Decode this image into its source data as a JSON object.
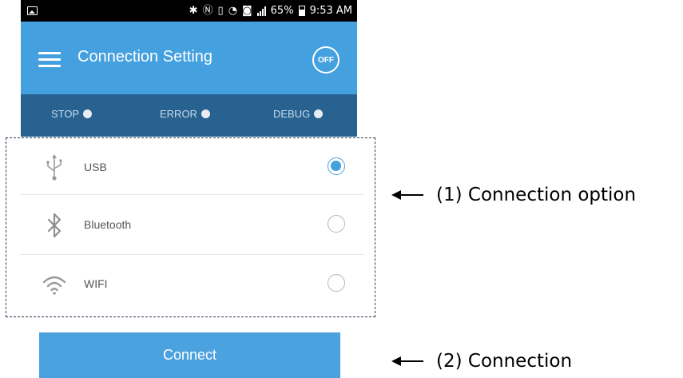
{
  "status_bar": {
    "battery_percent": "65%",
    "time": "9:53 AM"
  },
  "app_bar": {
    "title": "Connection Setting",
    "power_toggle_label": "OFF"
  },
  "indicators": [
    {
      "label": "STOP"
    },
    {
      "label": "ERROR"
    },
    {
      "label": "DEBUG"
    }
  ],
  "connection_options": [
    {
      "label": "USB",
      "icon": "usb-icon",
      "selected": true
    },
    {
      "label": "Bluetooth",
      "icon": "bluetooth-icon",
      "selected": false
    },
    {
      "label": "WIFI",
      "icon": "wifi-icon",
      "selected": false
    }
  ],
  "connect_button_label": "Connect",
  "annotations": [
    {
      "text": "(1) Connection option"
    },
    {
      "text": "(2) Connection"
    }
  ],
  "colors": {
    "app_bar": "#44a0de",
    "status_strip": "#286291",
    "accent": "#44a0de"
  }
}
